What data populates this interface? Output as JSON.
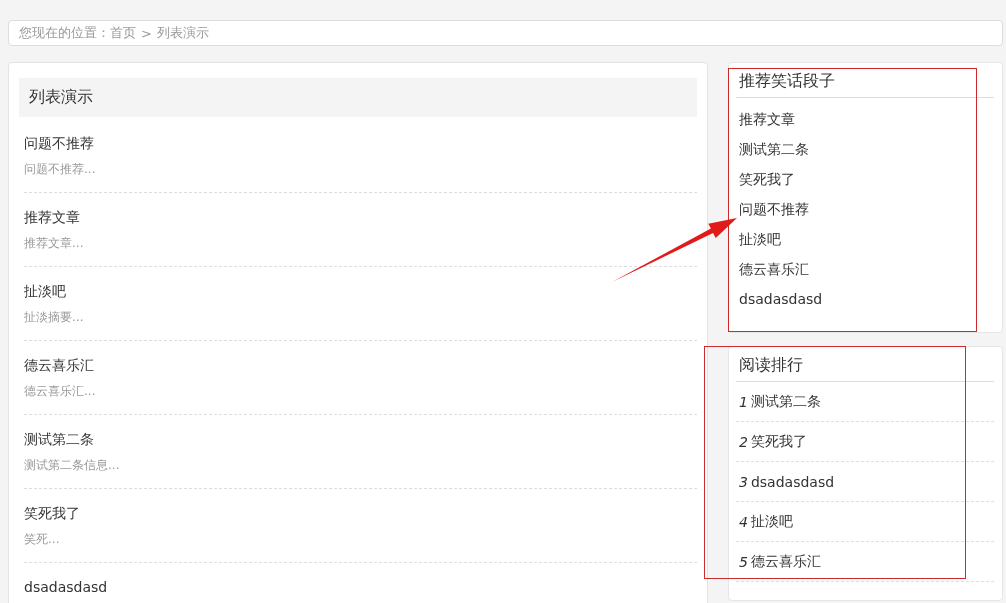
{
  "breadcrumb": {
    "items": [
      {
        "kind": "label",
        "text": "您现在的位置："
      },
      {
        "kind": "link",
        "text": "首页"
      },
      {
        "kind": "separator",
        "text": ">"
      },
      {
        "kind": "current",
        "text": "列表演示"
      }
    ]
  },
  "article_list": {
    "title": "列表演示",
    "items": [
      {
        "title": "问题不推荐",
        "summary": "问题不推荐..."
      },
      {
        "title": "推荐文章",
        "summary": "推荐文章..."
      },
      {
        "title": "扯淡吧",
        "summary": "扯淡摘要..."
      },
      {
        "title": "德云喜乐汇",
        "summary": "德云喜乐汇..."
      },
      {
        "title": "测试第二条",
        "summary": "测试第二条信息..."
      },
      {
        "title": "笑死我了",
        "summary": "笑死..."
      },
      {
        "title": "dsadasdasd"
      }
    ]
  },
  "sidebar": [
    {
      "kind": "links",
      "title": "推荐笑话段子",
      "items": [
        {
          "title": "推荐文章"
        },
        {
          "title": "测试第二条"
        },
        {
          "title": "笑死我了"
        },
        {
          "title": "问题不推荐"
        },
        {
          "title": "扯淡吧"
        },
        {
          "title": "德云喜乐汇"
        },
        {
          "title": "dsadasdasd"
        }
      ]
    },
    {
      "kind": "ranking",
      "title": "阅读排行",
      "items": [
        {
          "rank": "1",
          "title": "测试第二条"
        },
        {
          "rank": "2",
          "title": "笑死我了"
        },
        {
          "rank": "3",
          "title": "dsadasdasd"
        },
        {
          "rank": "4",
          "title": "扯淡吧"
        },
        {
          "rank": "5",
          "title": "德云喜乐汇"
        }
      ]
    }
  ]
}
